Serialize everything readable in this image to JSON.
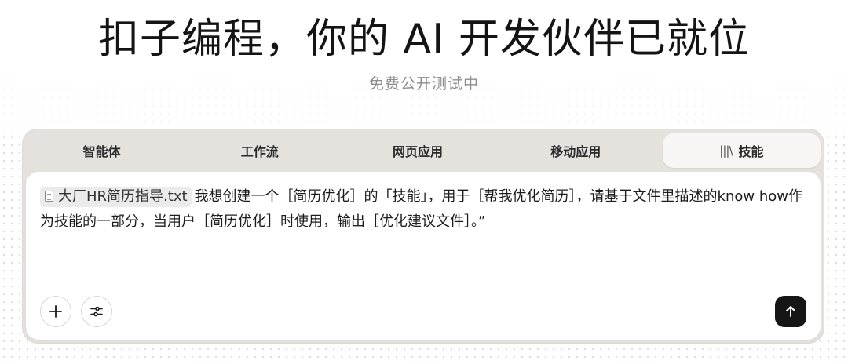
{
  "hero": {
    "title": "扣子编程，你的 AI 开发伙伴已就位",
    "subtitle": "免费公开测试中"
  },
  "tabs": [
    {
      "label": "智能体",
      "active": false
    },
    {
      "label": "工作流",
      "active": false
    },
    {
      "label": "网页应用",
      "active": false
    },
    {
      "label": "移动应用",
      "active": false
    },
    {
      "label": "技能",
      "active": true,
      "icon": "library-icon",
      "icon_text": "|||\\"
    }
  ],
  "prompt": {
    "attachment": {
      "name": "大厂HR简历指导.txt",
      "icon": "document-icon"
    },
    "text": "我想创建一个［简历优化］的「技能」，用于［帮我优化简历］，请基于文件里描述的know how作为技能的一部分，当用户［简历优化］时使用，输出［优化建议文件］。”"
  },
  "toolbar": {
    "add_icon": "plus-icon",
    "settings_icon": "sliders-icon",
    "send_icon": "arrow-up-icon"
  },
  "colors": {
    "panel": "#e5e2de",
    "send_button": "#161616",
    "subtitle": "#8d8d8d"
  }
}
